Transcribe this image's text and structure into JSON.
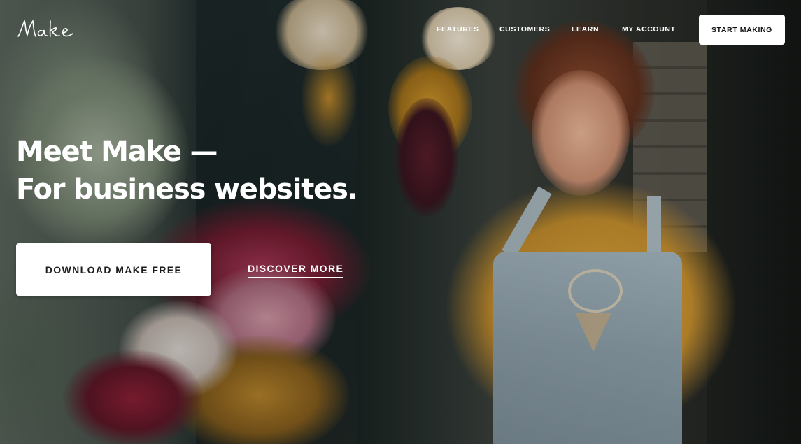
{
  "brand": {
    "logo_text": "Make"
  },
  "nav": {
    "items": [
      "FEATURES",
      "CUSTOMERS",
      "LEARN",
      "MY ACCOUNT"
    ],
    "cta_label": "START MAKING"
  },
  "hero": {
    "headline_line1": "Meet Make —",
    "headline_line2": "For business websites.",
    "primary_button": "DOWNLOAD MAKE FREE",
    "secondary_link": "DISCOVER MORE",
    "background_image": "florist-woman-with-flowers-photo"
  },
  "colors": {
    "text_on_hero": "#ffffff",
    "button_bg": "#ffffff",
    "button_text": "#1b1b1b"
  }
}
